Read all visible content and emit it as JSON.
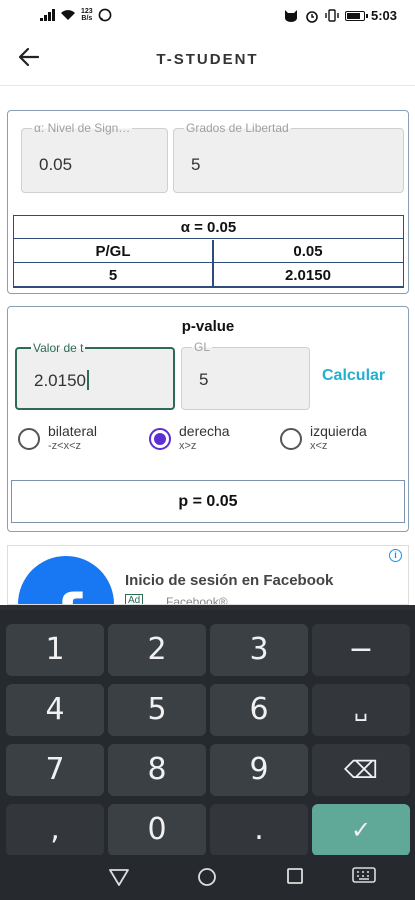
{
  "status_bar": {
    "network_speed_top": "123",
    "network_speed_unit": "B/s",
    "time": "5:03"
  },
  "app_bar": {
    "title": "T-STUDENT",
    "back_icon": "arrow-left-icon"
  },
  "critical_value": {
    "alpha_field": {
      "label": "α: Nivel de Sign…",
      "value": "0.05"
    },
    "df_field": {
      "label": "Grados de Libertad",
      "value": "5"
    },
    "table": {
      "header": "α = 0.05",
      "columns": [
        "P/GL",
        "0.05"
      ],
      "rows": [
        [
          "5",
          "2.0150"
        ]
      ]
    }
  },
  "p_value": {
    "title": "p-value",
    "t_field": {
      "label": "Valor de t",
      "value": "2.0150"
    },
    "gl_field": {
      "label": "GL",
      "value": "5"
    },
    "calculate_label": "Calcular",
    "options": [
      {
        "label": "bilateral",
        "sub": "-z<x<z",
        "selected": false
      },
      {
        "label": "derecha",
        "sub": "x>z",
        "selected": true
      },
      {
        "label": "izquierda",
        "sub": "x<z",
        "selected": false
      }
    ],
    "result": "p = 0.05"
  },
  "ad": {
    "title": "Inicio de sesión en Facebook",
    "tag": "Ad",
    "advertiser": "Facebook®",
    "info": "i"
  },
  "keyboard": {
    "keys": [
      "1",
      "2",
      "3",
      "−",
      "4",
      "5",
      "6",
      "␣",
      "7",
      "8",
      "9",
      "⌫",
      ",",
      "0",
      ".",
      "✓"
    ]
  }
}
